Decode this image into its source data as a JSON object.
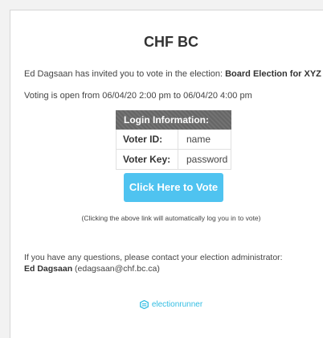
{
  "email": {
    "title": "CHF BC",
    "invite_prefix": "Ed Dagsaan has invited you to vote in the election: ",
    "election_name": "Board Election for XYZ Co-op",
    "voting_window": "Voting is open from 06/04/20 2:00 pm to 06/04/20 4:00 pm",
    "login": {
      "header": "Login Information:",
      "voter_id_label": "Voter ID:",
      "voter_id_value": "name",
      "voter_key_label": "Voter Key:",
      "voter_key_value": "password"
    },
    "vote_button_label": "Click Here to Vote",
    "auto_login_note": "(Clicking the above link will automatically log you in to vote)",
    "contact_text": "If you have any questions, please contact your election administrator:",
    "admin_name": "Ed Dagsaan",
    "admin_email": " (edagsaan@chf.bc.ca)",
    "brand_name": "electionrunner"
  },
  "colors": {
    "accent": "#4fc3f0",
    "brand": "#32bde2",
    "header_gray": "#6b6b6b"
  },
  "icons": {
    "brand_logo": "electionrunner-logo-icon"
  }
}
